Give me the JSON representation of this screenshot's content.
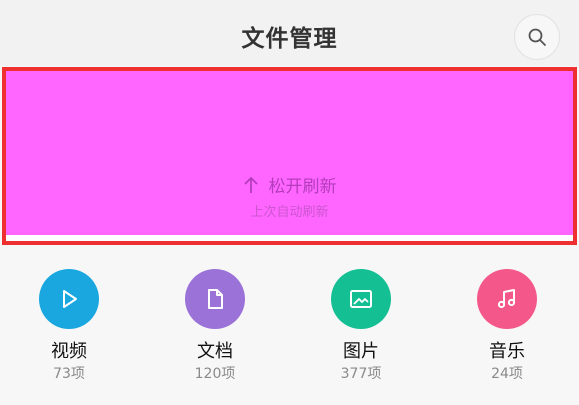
{
  "header": {
    "title": "文件管理",
    "search_icon": "search-icon"
  },
  "refresh": {
    "status": "松开刷新",
    "subtext": "上次自动刷新",
    "fill_color": "#ff66ff",
    "border_color": "#ef3030"
  },
  "categories": [
    {
      "label": "视频",
      "count": "73项",
      "icon": "play-icon",
      "color": "#1aa7e0"
    },
    {
      "label": "文档",
      "count": "120项",
      "icon": "document-icon",
      "color": "#9a72d8"
    },
    {
      "label": "图片",
      "count": "377项",
      "icon": "image-icon",
      "color": "#14bf94"
    },
    {
      "label": "音乐",
      "count": "24项",
      "icon": "music-note-icon",
      "color": "#f4588a"
    }
  ]
}
